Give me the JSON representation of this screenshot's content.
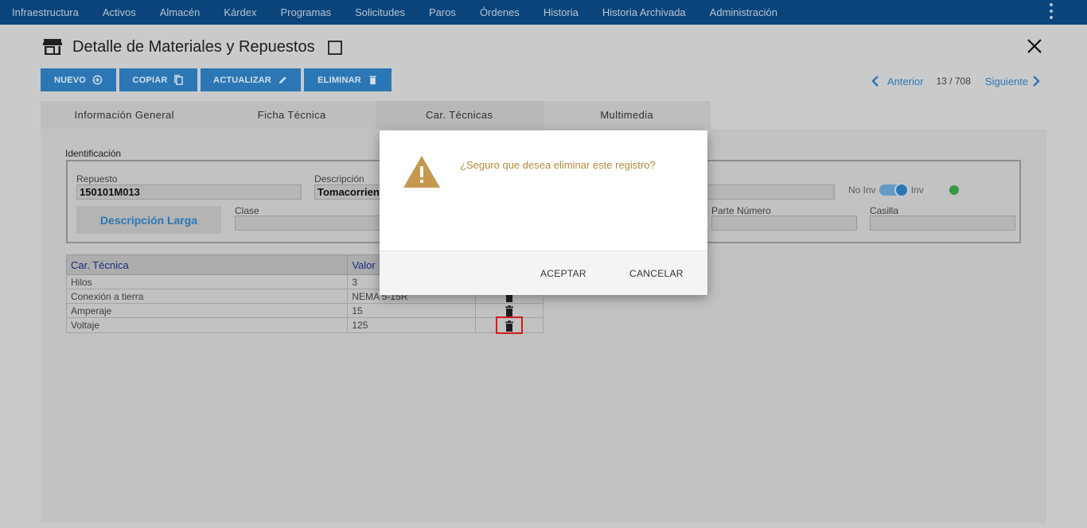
{
  "nav": {
    "items": [
      "Infraestructura",
      "Activos",
      "Almacén",
      "Kárdex",
      "Programas",
      "Solicitudes",
      "Paros",
      "Órdenes",
      "Historia",
      "Historia Archivada",
      "Administración"
    ]
  },
  "header": {
    "title": "Detalle de Materiales y Repuestos"
  },
  "toolbar": {
    "nuevo": "NUEVO",
    "copiar": "COPIAR",
    "actualizar": "ACTUALIZAR",
    "eliminar": "ELIMINAR"
  },
  "pager": {
    "prev": "Anterior",
    "count": "13 / 708",
    "next": "Siguiente"
  },
  "tabs": [
    "Información General",
    "Ficha Técnica",
    "Car. Técnicas",
    "Multimedia"
  ],
  "ident": {
    "section_label": "Identificación",
    "repuesto_label": "Repuesto",
    "repuesto_value": "150101M013",
    "descripcion_label": "Descripción",
    "descripcion_value": "Tomacorriente",
    "desc_larga_button": "Descripción Larga",
    "clase_label": "Clase",
    "parte_numero_label": "Parte Número",
    "casilla_label": "Casilla",
    "toggle_off_label": "No Inv",
    "toggle_on_label": "Inv"
  },
  "table": {
    "headers": [
      "Car. Técnica",
      "Valor"
    ],
    "rows": [
      {
        "car": "Hilos",
        "valor": "3"
      },
      {
        "car": "Conexión a tierra",
        "valor": "NEMA 5-15R"
      },
      {
        "car": "Amperaje",
        "valor": "15"
      },
      {
        "car": "Voltaje",
        "valor": "125"
      }
    ]
  },
  "modal": {
    "message": "¿Seguro que desea eliminar este registro?",
    "accept": "ACEPTAR",
    "cancel": "CANCELAR"
  },
  "colors": {
    "nav_bg": "#0b4a86",
    "accent": "#2f82c6",
    "warning": "#c4984f",
    "status_ok": "#3aa54a"
  }
}
